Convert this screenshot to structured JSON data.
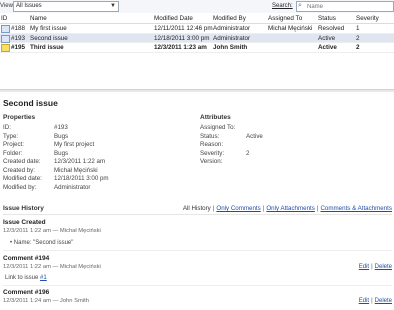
{
  "toolbar": {
    "view_label": "View:",
    "view_value": "All Issues",
    "search_label": "Search:",
    "search_placeholder": "Name"
  },
  "grid": {
    "columns": [
      "ID",
      "Name",
      "Modified Date",
      "Modified By",
      "Assigned To",
      "Status",
      "Severity"
    ],
    "rows": [
      {
        "id": "#188",
        "name": "My first issue",
        "modified": "12/11/2011 12:46 pm",
        "by": "Administrator",
        "assigned": "Michał Męciński",
        "status": "Resolved",
        "severity": "1"
      },
      {
        "id": "#193",
        "name": "Second issue",
        "modified": "12/18/2011 3:00 pm",
        "by": "Administrator",
        "assigned": "",
        "status": "Active",
        "severity": "2"
      },
      {
        "id": "#195",
        "name": "Third issue",
        "modified": "12/3/2011 1:23 am",
        "by": "John Smith",
        "assigned": "",
        "status": "Active",
        "severity": "2"
      }
    ]
  },
  "detail": {
    "title": "Second issue",
    "properties_head": "Properties",
    "properties": [
      {
        "k": "ID:",
        "v": "#193"
      },
      {
        "k": "Type:",
        "v": "Bugs"
      },
      {
        "k": "Project:",
        "v": "My first project"
      },
      {
        "k": "Folder:",
        "v": "Bugs"
      },
      {
        "k": "Created date:",
        "v": "12/3/2011 1:22 am"
      },
      {
        "k": "Created by:",
        "v": "Michał Męciński"
      },
      {
        "k": "Modified date:",
        "v": "12/18/2011 3:00 pm"
      },
      {
        "k": "Modified by:",
        "v": "Administrator"
      }
    ],
    "attributes_head": "Attributes",
    "attributes": [
      {
        "k": "Assigned To:",
        "v": ""
      },
      {
        "k": "Status:",
        "v": "Active"
      },
      {
        "k": "Reason:",
        "v": ""
      },
      {
        "k": "Severity:",
        "v": "2"
      },
      {
        "k": "Version:",
        "v": ""
      }
    ]
  },
  "history": {
    "head": "Issue History",
    "filter_all": "All History",
    "filter_comments": "Only Comments",
    "filter_attachments": "Only Attachments",
    "filter_both": "Comments & Attachments",
    "entries": [
      {
        "title": "Issue Created",
        "meta": "12/3/2011 1:22 am — Michał Męciński",
        "body": "Name: \"Second issue\""
      },
      {
        "title": "Comment #194",
        "meta": "12/3/2011 1:22 am — Michał Męciński",
        "body_prefix": "Link to issue ",
        "body_link": "#1",
        "edit": "Edit",
        "delete": "Delete"
      },
      {
        "title": "Comment #196",
        "meta": "12/3/2011 1:24 am — John Smith",
        "edit": "Edit",
        "delete": "Delete"
      }
    ]
  }
}
